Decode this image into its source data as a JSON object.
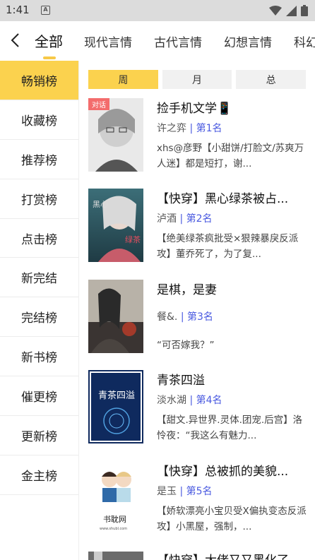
{
  "status": {
    "time": "1:41",
    "app_icon": "A"
  },
  "tabs": [
    {
      "label": "全部"
    },
    {
      "label": "现代言情"
    },
    {
      "label": "古代言情"
    },
    {
      "label": "幻想言情"
    },
    {
      "label": "科幻"
    }
  ],
  "sidebar": [
    {
      "label": "畅销榜"
    },
    {
      "label": "收藏榜"
    },
    {
      "label": "推荐榜"
    },
    {
      "label": "打赏榜"
    },
    {
      "label": "点击榜"
    },
    {
      "label": "新完结"
    },
    {
      "label": "完结榜"
    },
    {
      "label": "新书榜"
    },
    {
      "label": "催更榜"
    },
    {
      "label": "更新榜"
    },
    {
      "label": "金主榜"
    }
  ],
  "periods": [
    {
      "label": "周"
    },
    {
      "label": "月"
    },
    {
      "label": "总"
    }
  ],
  "books": [
    {
      "badge": "对话",
      "title": "捡手机文学📱",
      "author": "许之弈",
      "rank": "第1名",
      "desc": "xhs@彦野【小甜饼/打脸文/苏爽万人迷】都是短打，谢..."
    },
    {
      "badge": "",
      "title": "【快穿】黑心绿茶被占...",
      "author": "泸酒",
      "rank": "第2名",
      "desc": "【绝美绿茶疯批受×狠辣暴戾反派攻】董乔死了，为了复..."
    },
    {
      "badge": "",
      "title": "是棋，是妻",
      "author": "餐&.",
      "rank": "第3名",
      "desc": "“可否嫁我？”"
    },
    {
      "badge": "",
      "title": "青茶四溢",
      "author": "淡水湖",
      "rank": "第4名",
      "desc": "【甜文.异世界.灵体.团宠.后宫】洛怜夜：“我这么有魅力..."
    },
    {
      "badge": "",
      "title": "【快穿】总被抓的美貌...",
      "author": "是玉",
      "rank": "第5名",
      "desc": "【娇软漂亮小宝贝受X偏执变态反派攻】小黑屋，强制，..."
    },
    {
      "badge": "",
      "title": "【快穿】大佬又又黑化了",
      "author": "",
      "rank": "",
      "desc": ""
    }
  ],
  "cover4": {
    "text": "青茶四溢"
  },
  "cover5": {
    "text": "书耽网",
    "sub": "www.shubl.com"
  },
  "colors": {
    "accent": "#fbd24e",
    "rank": "#4a5ae0",
    "badge": "#f36c6c"
  }
}
